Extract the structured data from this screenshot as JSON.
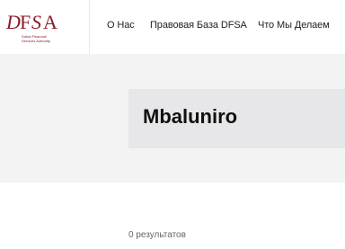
{
  "header": {
    "logo": {
      "mark_text": "DFSA",
      "caption_lines": [
        "Dubai Financial",
        "Services Authority"
      ]
    },
    "nav": [
      {
        "label": "О Нас"
      },
      {
        "label": "Правовая База DFSA"
      },
      {
        "label": "Что Мы Делаем"
      }
    ]
  },
  "hero": {
    "title": "Mbaluniro"
  },
  "results": {
    "label": "0 результатов"
  },
  "colors": {
    "brand": "#8b1c2b",
    "hero_bg": "#f3f3f4",
    "title_box_bg": "#e7e7e9"
  }
}
